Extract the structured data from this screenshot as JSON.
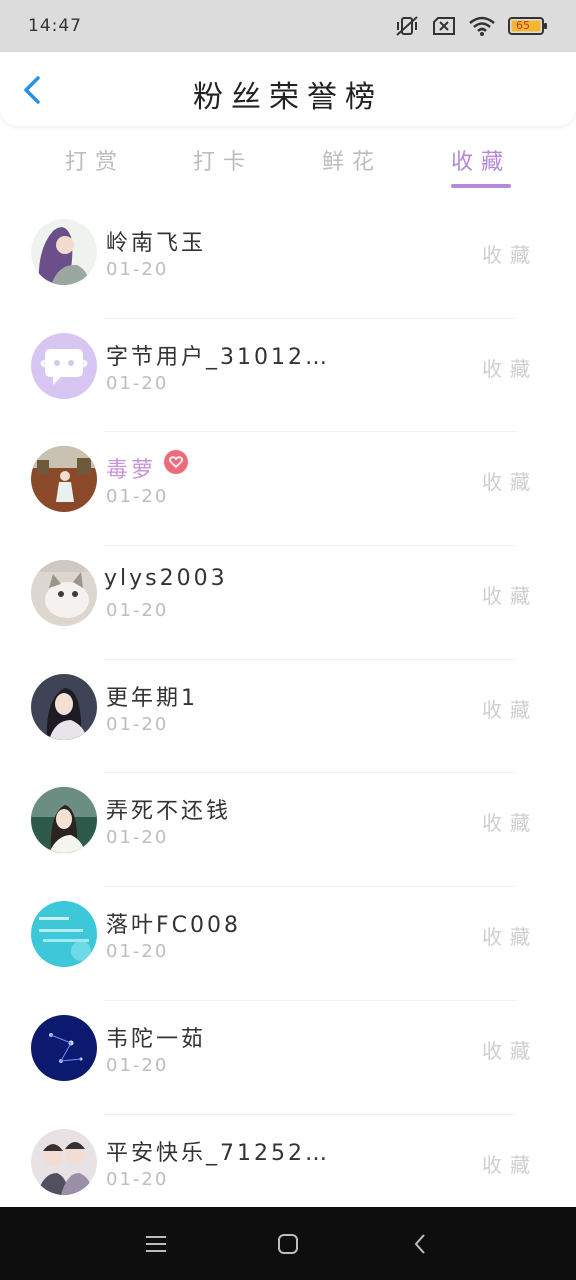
{
  "status_bar": {
    "time": "14:47",
    "battery_level": "65",
    "icons": [
      "mute-vibrate-icon",
      "no-sim-icon",
      "wifi-icon",
      "battery-icon"
    ]
  },
  "header": {
    "title": "粉丝荣誉榜",
    "back_icon": "chevron-left-icon"
  },
  "tabs": [
    {
      "label": "打赏",
      "active": false
    },
    {
      "label": "打卡",
      "active": false
    },
    {
      "label": "鲜花",
      "active": false
    },
    {
      "label": "收藏",
      "active": true
    }
  ],
  "colors": {
    "accent": "#b48ad8",
    "inactive_tab": "#bdbdbd",
    "date": "#bdbdbd",
    "action": "#cfcfcf",
    "vip_name": "#c895d8",
    "badge": "#ef6b7a"
  },
  "fans": [
    {
      "name": "岭南飞玉",
      "date": "01-20",
      "action": "收藏"
    },
    {
      "name": "字节用户_31012…",
      "date": "01-20",
      "action": "收藏"
    },
    {
      "name": "毒萝",
      "date": "01-20",
      "action": "收藏",
      "badge": "heart-badge-icon"
    },
    {
      "name": "ylys2003",
      "date": "01-20",
      "action": "收藏"
    },
    {
      "name": "更年期1",
      "date": "01-20",
      "action": "收藏"
    },
    {
      "name": "弄死不还钱",
      "date": "01-20",
      "action": "收藏"
    },
    {
      "name": "落叶FC008",
      "date": "01-20",
      "action": "收藏"
    },
    {
      "name": "韦陀一茹",
      "date": "01-20",
      "action": "收藏"
    },
    {
      "name": "平安快乐_71252…",
      "date": "01-20",
      "action": "收藏"
    }
  ],
  "nav_bar": {
    "icons": [
      "menu-icon",
      "home-icon",
      "back-icon"
    ]
  }
}
